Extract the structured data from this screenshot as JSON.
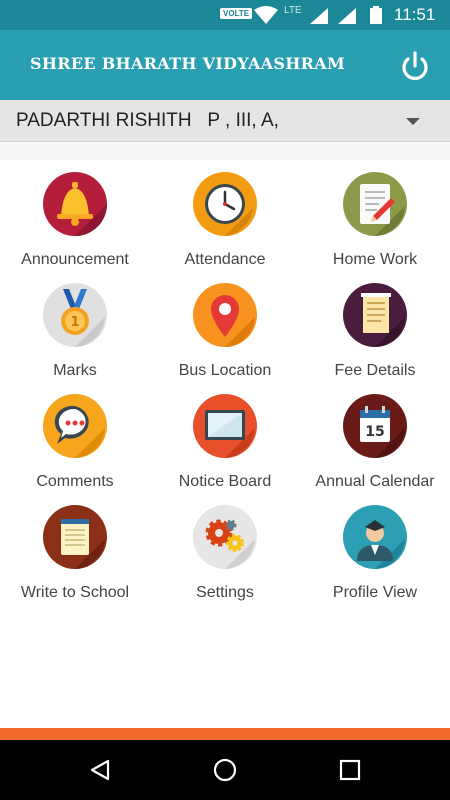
{
  "status_bar": {
    "volte": "VOLTE",
    "network": "LTE",
    "time": "11:51"
  },
  "app_bar": {
    "title": "SHREE BHARATH VIDYAASHRAM",
    "power_icon": "power-icon"
  },
  "student": {
    "selected": "PADARTHI RISHITH   P , III, A,"
  },
  "menu": [
    {
      "label": "Announcement",
      "icon": "bell-icon"
    },
    {
      "label": "Attendance",
      "icon": "clock-icon"
    },
    {
      "label": "Home Work",
      "icon": "notebook-pencil-icon"
    },
    {
      "label": "Marks",
      "icon": "medal-icon"
    },
    {
      "label": "Bus Location",
      "icon": "map-pin-icon"
    },
    {
      "label": "Fee Details",
      "icon": "receipt-icon"
    },
    {
      "label": "Comments",
      "icon": "chat-bubble-icon"
    },
    {
      "label": "Notice Board",
      "icon": "notice-board-icon"
    },
    {
      "label": "Annual Calendar",
      "icon": "calendar-icon"
    },
    {
      "label": "Write to School",
      "icon": "notepad-icon"
    },
    {
      "label": "Settings",
      "icon": "gears-icon"
    },
    {
      "label": "Profile View",
      "icon": "user-avatar-icon"
    }
  ],
  "calendar_day": "15",
  "colors": {
    "header": "#2a9fb2",
    "status_bar": "#1b8797",
    "accent_stripe": "#f26a2a"
  }
}
